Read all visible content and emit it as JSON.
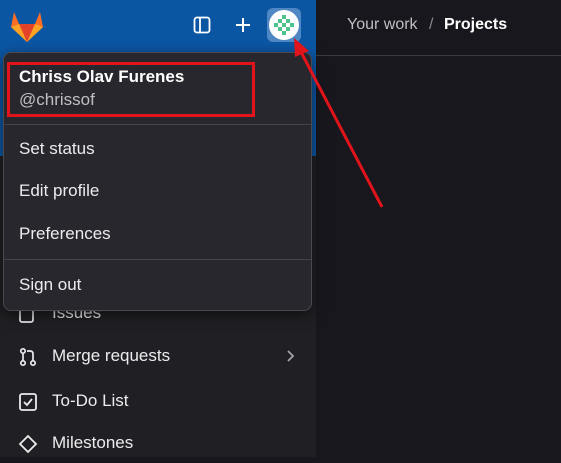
{
  "header": {
    "breadcrumb": [
      "Your work",
      "Projects"
    ],
    "separator": "/"
  },
  "sidebar": {
    "toggle_icon": "sidebar-toggle-icon",
    "new_icon": "plus-icon",
    "nav": [
      {
        "label": "Issues",
        "icon": "issues-icon"
      },
      {
        "label": "Merge requests",
        "icon": "merge-request-icon",
        "has_chevron": true
      },
      {
        "label": "To-Do List",
        "icon": "todo-icon"
      },
      {
        "label": "Milestones",
        "icon": "milestone-icon"
      }
    ]
  },
  "user_menu": {
    "name": "Chriss Olav Furenes",
    "handle": "@chrissof",
    "items": [
      "Set status",
      "Edit profile",
      "Preferences"
    ],
    "sign_out": "Sign out"
  },
  "colors": {
    "sidebar_accent": "#0b56a3",
    "annotation": "#e0141a"
  }
}
